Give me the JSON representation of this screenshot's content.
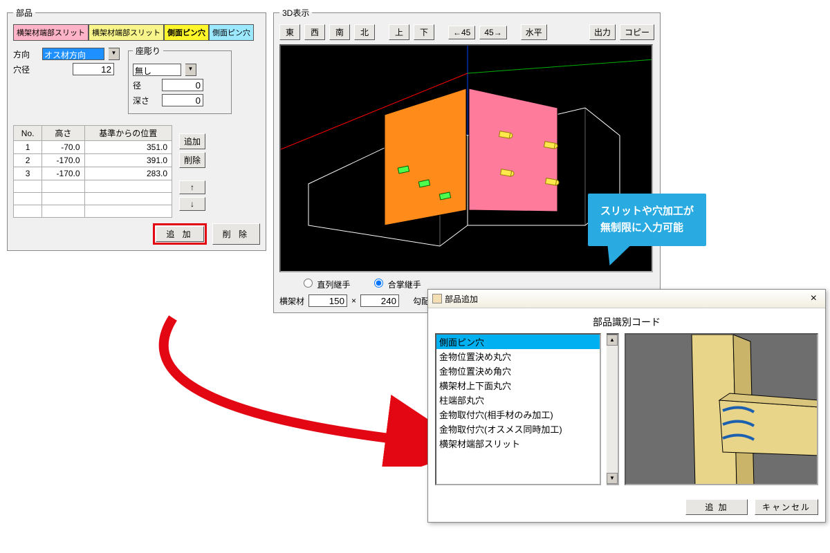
{
  "parts": {
    "legend": "部品",
    "tabs": [
      "横架材端部スリット",
      "横架材端部スリット",
      "側面ピン穴",
      "側面ピン穴"
    ],
    "direction_label": "方向",
    "direction_value": "オス材方向",
    "diameter_label": "穴径",
    "diameter_value": "12",
    "zaguri": {
      "legend": "座彫り",
      "type_value": "無し",
      "dia_label": "径",
      "dia_value": "0",
      "depth_label": "深さ",
      "depth_value": "0"
    },
    "table": {
      "headers": [
        "No.",
        "高さ",
        "基準からの位置"
      ],
      "rows": [
        [
          "1",
          "-70.0",
          "351.0"
        ],
        [
          "2",
          "-170.0",
          "391.0"
        ],
        [
          "3",
          "-170.0",
          "283.0"
        ]
      ]
    },
    "side_buttons": {
      "add": "追加",
      "delete": "削除",
      "up": "↑",
      "down": "↓"
    },
    "bottom_buttons": {
      "add": "追 加",
      "delete": "削 除"
    }
  },
  "view3d": {
    "legend": "3D表示",
    "nav": [
      "東",
      "西",
      "南",
      "北"
    ],
    "nav2": [
      "上",
      "下"
    ],
    "nav3": [
      "←45",
      "45→"
    ],
    "level": "水平",
    "export": "出力",
    "copy": "コピー",
    "radio": {
      "chokuretsu": "直列継手",
      "gassho": "合掌継手"
    },
    "dims": {
      "label": "横架材",
      "w": "150",
      "x": "×",
      "h": "240",
      "slope": "勾配"
    }
  },
  "dialog": {
    "title": "部品追加",
    "heading": "部品識別コード",
    "items": [
      "側面ピン穴",
      "金物位置決め丸穴",
      "金物位置決め角穴",
      "横架材上下面丸穴",
      "柱端部丸穴",
      "金物取付穴(相手材のみ加工)",
      "金物取付穴(オスメス同時加工)",
      "横架材端部スリット"
    ],
    "selected_index": 0,
    "footer": {
      "add": "追 加",
      "cancel": "キャンセル"
    }
  },
  "callout": {
    "line1": "スリットや穴加工が",
    "line2": "無制限に入力可能"
  },
  "colors": {
    "accent_red": "#e30613",
    "callout_blue": "#29abe2",
    "sel_blue": "#00b0f0"
  }
}
